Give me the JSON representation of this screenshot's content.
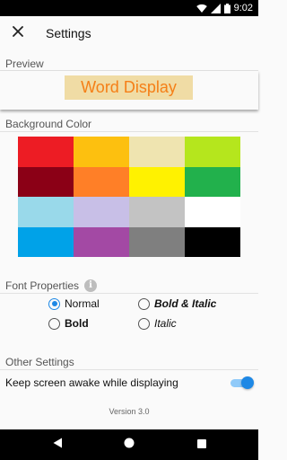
{
  "status_bar": {
    "time": "9:02"
  },
  "app_bar": {
    "title": "Settings"
  },
  "preview": {
    "header": "Preview",
    "word": "Word Display"
  },
  "background": {
    "header": "Background Color",
    "colors": [
      "#ed1c24",
      "#fdc00f",
      "#efe4b0",
      "#b5e61d",
      "#8b0016",
      "#ff7f27",
      "#fff200",
      "#22b14c",
      "#99d9ea",
      "#c8bfe7",
      "#c3c3c3",
      "#ffffff",
      "#00a2e8",
      "#a349a4",
      "#7f7f7f",
      "#000000"
    ]
  },
  "font_properties": {
    "header": "Font Properties",
    "options": [
      {
        "label": "Normal",
        "checked": true
      },
      {
        "label": "Bold & Italic",
        "checked": false
      },
      {
        "label": "Bold",
        "checked": false
      },
      {
        "label": "Italic",
        "checked": false
      }
    ]
  },
  "other_settings": {
    "header": "Other Settings",
    "keep_awake_label": "Keep screen awake while displaying",
    "keep_awake_on": true
  },
  "version": "Version 3.0"
}
